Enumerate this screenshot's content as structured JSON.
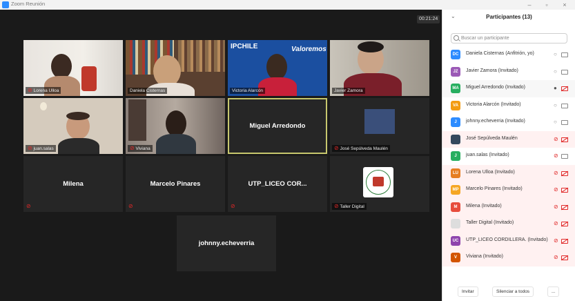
{
  "window": {
    "title": "Zoom Reunión",
    "minimize": "–",
    "maximize": "▫",
    "close": "×"
  },
  "meeting": {
    "timer": "00:21:24"
  },
  "tiles": {
    "lorena": "Lorena Ulloa",
    "daniela": "Daniela Cisternas",
    "victoria": "Victoria Alarcón",
    "javier": "Javier Zamora",
    "juan": "juan.salas",
    "viviana": "Viviana",
    "miguel": "Miguel Arredondo",
    "jose": "José Sepúlveda Maulén",
    "milena": "Milena",
    "marcelo": "Marcelo Pinares",
    "utp": "UTP_LICEO COR...",
    "taller": "Taller Digital",
    "johnny": "johnny.echeverria",
    "ipchile_logo": "IPCHILE",
    "valoremos_logo": "Valoremos"
  },
  "panel": {
    "title": "Participantes (13)",
    "search_placeholder": "Buscar un participante",
    "participants": [
      {
        "initials": "DC",
        "name": "Daniela Cisternas (Anfitrión, yo)",
        "color": "#2d8cff"
      },
      {
        "initials": "JZ",
        "name": "Javier Zamora (Invitado)",
        "color": "#9b59b6"
      },
      {
        "initials": "MA",
        "name": "Miguel Arredondo (Invitado)",
        "color": "#27ae60"
      },
      {
        "initials": "VA",
        "name": "Victoria Alarcón (Invitado)",
        "color": "#f39c12"
      },
      {
        "initials": "J",
        "name": "johnny.echeverria (Invitado)",
        "color": "#2d8cff"
      },
      {
        "initials": "",
        "name": "José Sepúlveda Maulén",
        "color": "#34495e"
      },
      {
        "initials": "J",
        "name": "juan.salas (Invitado)",
        "color": "#27ae60"
      },
      {
        "initials": "LU",
        "name": "Lorena Ulloa (Invitado)",
        "color": "#e67e22"
      },
      {
        "initials": "MP",
        "name": "Marcelo Pinares (Invitado)",
        "color": "#f5a623"
      },
      {
        "initials": "M",
        "name": "Milena (Invitado)",
        "color": "#e74c3c"
      },
      {
        "initials": "",
        "name": "Taller Digital (Invitado)",
        "color": "#dddddd"
      },
      {
        "initials": "UC",
        "name": "UTP_LICEO CORDILLERA. (Invitado)",
        "color": "#8e44ad"
      },
      {
        "initials": "V",
        "name": "Viviana (Invitado)",
        "color": "#d35400"
      }
    ],
    "invite": "Invitar",
    "mute_all": "Silenciar a todos",
    "more": "..."
  },
  "colors": {
    "video_bg": "#1a1a1a",
    "tile_bg": "#262626",
    "active_border": "#c8c86e",
    "muted_red": "#e02828",
    "zoom_blue": "#2d8cff"
  }
}
